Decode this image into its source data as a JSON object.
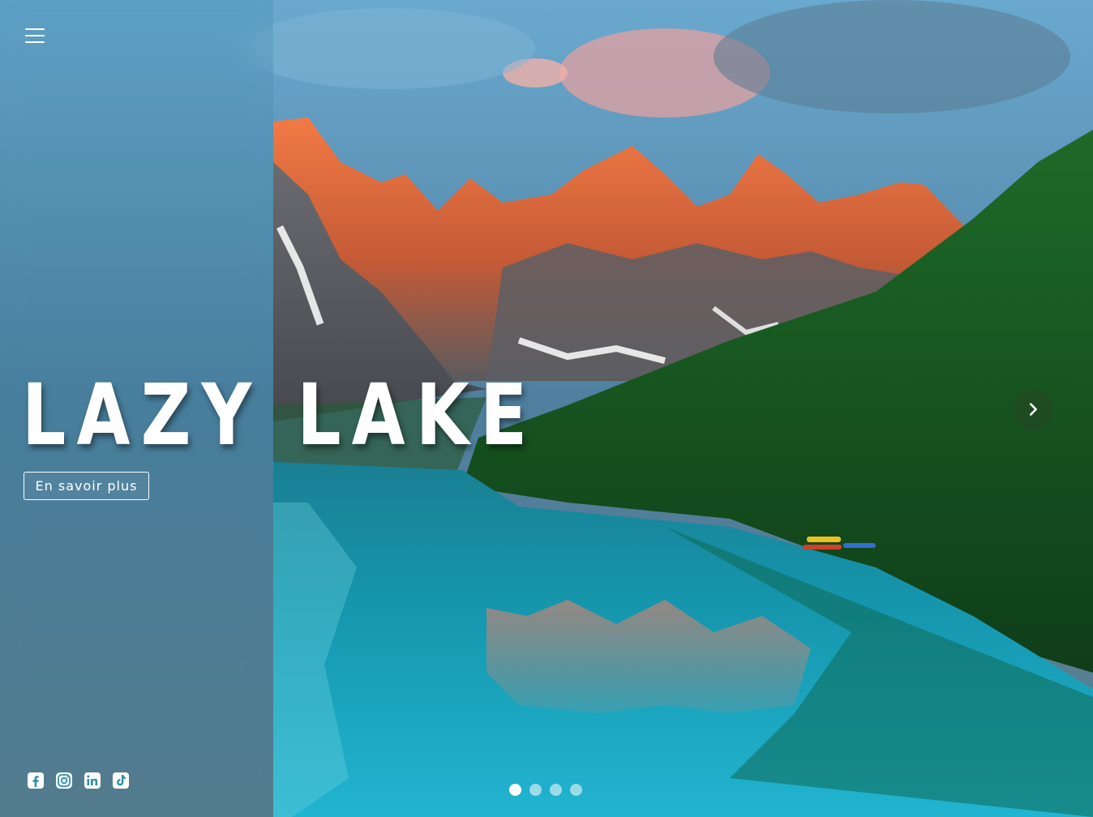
{
  "menu": {
    "icon": "hamburger-menu-icon"
  },
  "hero": {
    "title": "LAZY LAKE",
    "cta_label": "En savoir plus"
  },
  "socials": [
    {
      "name": "facebook",
      "icon": "facebook-icon"
    },
    {
      "name": "instagram",
      "icon": "instagram-icon"
    },
    {
      "name": "linkedin",
      "icon": "linkedin-icon"
    },
    {
      "name": "tiktok",
      "icon": "tiktok-icon"
    }
  ],
  "carousel": {
    "next_icon": "chevron-right-icon",
    "slide_count": 4,
    "active_slide": 1
  },
  "colors": {
    "text": "#ffffff",
    "lake": "#1aa0b8",
    "forest": "#1d5a23",
    "peaks": "#e8653a"
  }
}
